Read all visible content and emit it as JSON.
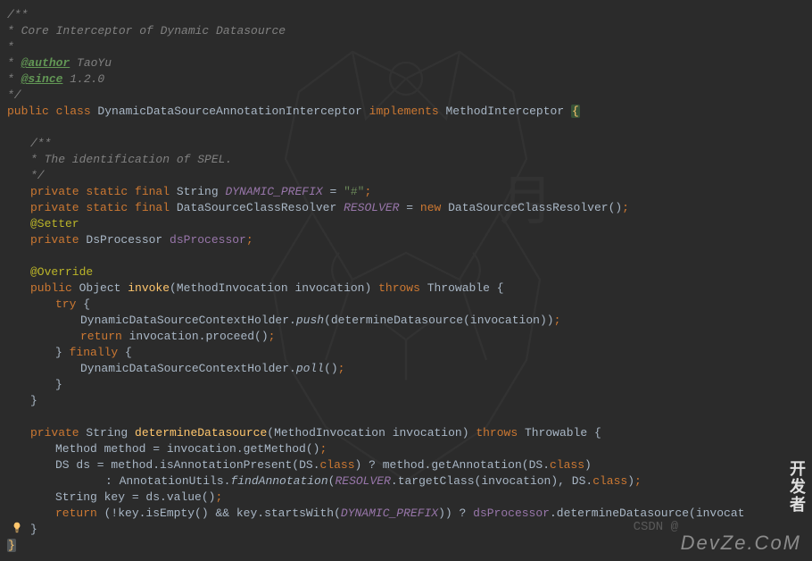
{
  "doc": {
    "line1": "/**",
    "line2": " * Core Interceptor of Dynamic Datasource",
    "line3": " *",
    "authorTag": "@author",
    "authorText": " TaoYu",
    "sinceTag": "@since",
    "sinceText": " 1.2.0",
    "lineEnd": " */"
  },
  "classDecl": {
    "public": "public ",
    "classKw": "class ",
    "name": "DynamicDataSourceAnnotationInterceptor ",
    "implements": "implements ",
    "interface": "MethodInterceptor ",
    "brace": "{"
  },
  "innerDoc": {
    "l1": "/**",
    "l2": " * The identification of SPEL.",
    "l3": " */"
  },
  "f1": {
    "private": "private ",
    "static": "static ",
    "final": "final ",
    "type": "String ",
    "name": "DYNAMIC_PREFIX",
    "eq": " = ",
    "value": "\"#\"",
    "semi": ";"
  },
  "f2": {
    "private": "private ",
    "static": "static ",
    "final": "final ",
    "type": "DataSourceClassResolver ",
    "name": "RESOLVER",
    "eq": " = ",
    "newKw": "new ",
    "ctor": "DataSourceClassResolver",
    "paren": "()",
    "semi": ";"
  },
  "setter": "@Setter",
  "f3": {
    "private": "private ",
    "type": "DsProcessor ",
    "name": "dsProcessor",
    "semi": ";"
  },
  "override": "@Override",
  "m1": {
    "public": "public ",
    "ret": "Object ",
    "name": "invoke",
    "open": "(",
    "ptype": "MethodInvocation ",
    "pname": "invocation",
    "close": ") ",
    "throws": "throws ",
    "exc": "Throwable ",
    "brace": "{"
  },
  "try": {
    "kw": "try ",
    "brace": "{"
  },
  "push": {
    "holder": "DynamicDataSourceContextHolder.",
    "push": "push",
    "open": "(",
    "det": "determineDatasource",
    "open2": "(",
    "inv": "invocation",
    "close2": ")",
    "close": ")",
    "semi": ";"
  },
  "ret1": {
    "ret": "return ",
    "inv": "invocation.",
    "proc": "proceed",
    "paren": "()",
    "semi": ";"
  },
  "fin": {
    "close": "} ",
    "kw": "finally ",
    "brace": "{"
  },
  "poll": {
    "holder": "DynamicDataSourceContextHolder.",
    "poll": "poll",
    "paren": "()",
    "semi": ";"
  },
  "closeBraces": {
    "b1": "}",
    "b2": "}"
  },
  "m2": {
    "private": "private ",
    "ret": "String ",
    "name": "determineDatasource",
    "open": "(",
    "ptype": "MethodInvocation ",
    "pname": "invocation",
    "close": ") ",
    "throws": "throws ",
    "exc": "Throwable ",
    "brace": "{"
  },
  "l_method": {
    "type": "Method ",
    "name": "method = invocation.",
    "call": "getMethod",
    "paren": "()",
    "semi": ";"
  },
  "l_ds": {
    "type": "DS ",
    "name": "ds = method.",
    "call1": "isAnnotationPresent",
    "open": "(",
    "ds1": "DS",
    "dot1": ".",
    "class1": "class",
    "close": ") ",
    "tern": "? method.",
    "call2": "getAnnotation",
    "open2": "(",
    "ds2": "DS",
    "dot2": ".",
    "class2": "class",
    "close2": ")"
  },
  "l_ds2": {
    "prefix": ": AnnotationUtils.",
    "find": "findAnnotation",
    "open": "(",
    "resolver": "RESOLVER",
    "dot": ".",
    "tc": "targetClass",
    "open2": "(",
    "inv": "invocation",
    "close2": ")",
    "comma": ", ",
    "ds": "DS",
    "dot2": ".",
    "class": "class",
    "close": ")",
    "semi": ";"
  },
  "l_key": {
    "type": "String ",
    "assign": "key = ds.",
    "call": "value",
    "paren": "()",
    "semi": ";"
  },
  "ret2": {
    "ret": "return ",
    "open": "(!key.",
    "isEmpty": "isEmpty",
    "paren1": "()",
    "and": " && key.",
    "starts": "startsWith",
    "open2": "(",
    "dynPrefix": "DYNAMIC_PREFIX",
    "close2": ")",
    "close": ") ",
    "tern": "? ",
    "dsProc": "dsProcessor",
    "dot": ".",
    "det": "determineDatasource",
    "open3": "(",
    "inv": "invocat"
  },
  "finalClose": "}",
  "watermark_csdn": "CSDN @",
  "watermark_logo": "DevZe.CoM",
  "logo_cn": "开发者"
}
